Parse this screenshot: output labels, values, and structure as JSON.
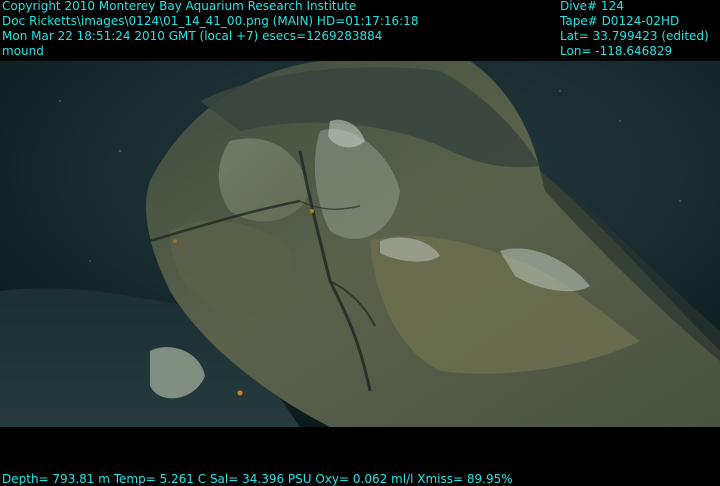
{
  "overlay": {
    "top_left": [
      "Copyright 2010 Monterey Bay Aquarium Research Institute",
      "Doc Ricketts\\images\\0124\\01_14_41_00.png (MAIN)  HD=01:17:16:18",
      "Mon Mar 22 18:51:24 2010 GMT (local +7)  esecs=1269283884",
      "mound"
    ],
    "top_right": [
      "Dive# 124",
      "Tape# D0124-02HD",
      "Lat= 33.799423 (edited)",
      "Lon= -118.646829"
    ],
    "bottom": "Depth= 793.81 m  Temp= 5.261 C  Sal= 34.396 PSU  Oxy= 0.062 ml/l  Xmiss= 89.95%"
  },
  "colors": {
    "overlay_text": "#22e5e5",
    "background": "#000000",
    "water_dark": "#0f1e22",
    "water_mid": "#1c3036",
    "rock_olive": "#5d6448",
    "rock_grey": "#8a948a",
    "bacterial_mat": "#c8d2cc"
  }
}
